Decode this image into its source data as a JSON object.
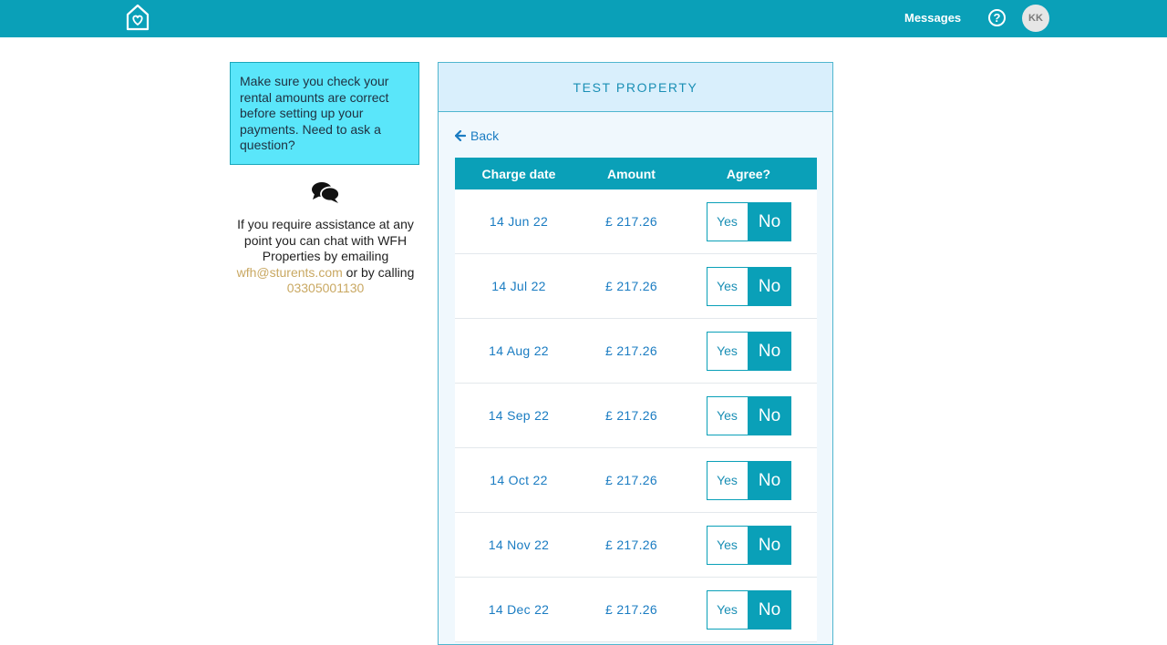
{
  "header": {
    "messages_label": "Messages",
    "help_symbol": "?",
    "avatar_initials": "KK",
    "logo_icon": "house-heart-icon",
    "brand_color": "#0aa0b8"
  },
  "sidebar": {
    "notice_text": "Make sure you check your rental amounts are correct before setting up your payments. Need to ask a question?",
    "chat_icon": "chat-bubbles-icon",
    "help_prefix": "If you require assistance at any point you can chat with WFH Properties by emailing",
    "email": "wfh@sturents.com",
    "help_middle": "or by calling",
    "phone": "03305001130"
  },
  "card": {
    "title": "TEST PROPERTY",
    "back_label": "Back",
    "back_icon": "arrow-left-icon",
    "columns": {
      "date": "Charge date",
      "amount": "Amount",
      "agree": "Agree?"
    },
    "rows": [
      {
        "date": "14 Jun 22",
        "amount": "£ 217.26",
        "yes": "Yes",
        "no": "No"
      },
      {
        "date": "14 Jul 22",
        "amount": "£ 217.26",
        "yes": "Yes",
        "no": "No"
      },
      {
        "date": "14 Aug 22",
        "amount": "£ 217.26",
        "yes": "Yes",
        "no": "No"
      },
      {
        "date": "14 Sep 22",
        "amount": "£ 217.26",
        "yes": "Yes",
        "no": "No"
      },
      {
        "date": "14 Oct 22",
        "amount": "£ 217.26",
        "yes": "Yes",
        "no": "No"
      },
      {
        "date": "14 Nov 22",
        "amount": "£ 217.26",
        "yes": "Yes",
        "no": "No"
      },
      {
        "date": "14 Dec 22",
        "amount": "£ 217.26",
        "yes": "Yes",
        "no": "No"
      }
    ]
  }
}
